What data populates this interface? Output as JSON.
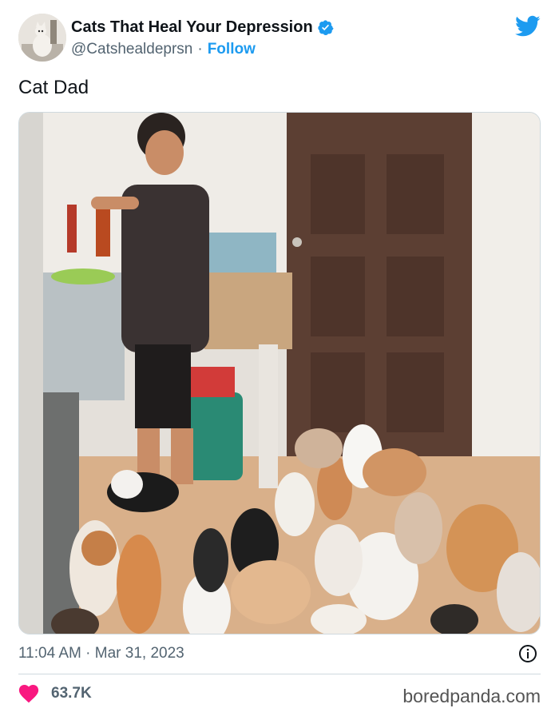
{
  "header": {
    "display_name": "Cats That Heal Your Depression",
    "handle": "@Catshealdeprsn",
    "separator": "·",
    "follow_label": "Follow"
  },
  "tweet": {
    "text": "Cat Dad"
  },
  "meta": {
    "timestamp": "11:04 AM · Mar 31, 2023"
  },
  "footer": {
    "like_count": "63.7K",
    "watermark": "boredpanda.com"
  },
  "colors": {
    "accent": "#1d9bf0",
    "like": "#f91880",
    "secondary_text": "#536471"
  },
  "icons": {
    "verified": "verified-badge-icon",
    "brand": "twitter-bird-icon",
    "info": "info-icon",
    "like": "heart-icon"
  }
}
